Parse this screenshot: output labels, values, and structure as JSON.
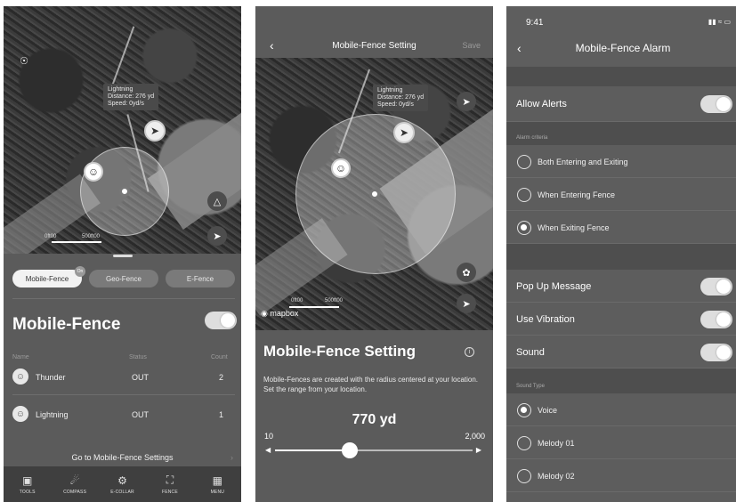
{
  "panel1": {
    "map": {
      "tooltip": [
        "Lightning",
        "Distance: 276 yd",
        "Speed: 0yd/s"
      ],
      "scale_left": "0ft00",
      "scale_right": "500ft00"
    },
    "pills": [
      "Mobile-Fence",
      "Geo-Fence",
      "E-Fence"
    ],
    "pill_badge": "On",
    "title": "Mobile-Fence",
    "columns": [
      "Name",
      "Status",
      "Count"
    ],
    "rows": [
      {
        "name": "Thunder",
        "status": "OUT",
        "count": "2"
      },
      {
        "name": "Lightning",
        "status": "OUT",
        "count": "1"
      }
    ],
    "goto": "Go to Mobile-Fence Settings",
    "tabs": [
      {
        "label": "TOOLS",
        "icon": "map-icon"
      },
      {
        "label": "COMPASS",
        "icon": "compass-icon"
      },
      {
        "label": "E-COLLAR",
        "icon": "collar-icon"
      },
      {
        "label": "FENCE",
        "icon": "fence-icon"
      },
      {
        "label": "MENU",
        "icon": "grid-icon"
      }
    ]
  },
  "panel2": {
    "nav_title": "Mobile-Fence Setting",
    "save": "Save",
    "tooltip": [
      "Lightning",
      "Distance: 276 yd",
      "Speed: 0yd/s"
    ],
    "scale_left": "0ft00",
    "scale_right": "500ft00",
    "mapbox": "mapbox",
    "title": "Mobile-Fence Setting",
    "description": "Mobile-Fences are created with the radius centered at your location. Set the range from your location.",
    "range_value": "770 yd",
    "range_min": "10",
    "range_max": "2,000",
    "slider_fraction": 0.38
  },
  "panel3": {
    "time": "9:41",
    "title": "Mobile-Fence Alarm",
    "allow_alerts": "Allow Alerts",
    "alarm_criteria": "Alarm criteria",
    "criteria": [
      {
        "label": "Both Entering and Exiting",
        "selected": false
      },
      {
        "label": "When Entering Fence",
        "selected": false
      },
      {
        "label": "When Exiting Fence",
        "selected": true
      }
    ],
    "pop_up": "Pop Up Message",
    "vibration": "Use Vibration",
    "sound": "Sound",
    "sound_type": "Sound Type",
    "sounds": [
      {
        "label": "Voice",
        "selected": true
      },
      {
        "label": "Melody 01",
        "selected": false
      },
      {
        "label": "Melody 02",
        "selected": false
      }
    ]
  }
}
